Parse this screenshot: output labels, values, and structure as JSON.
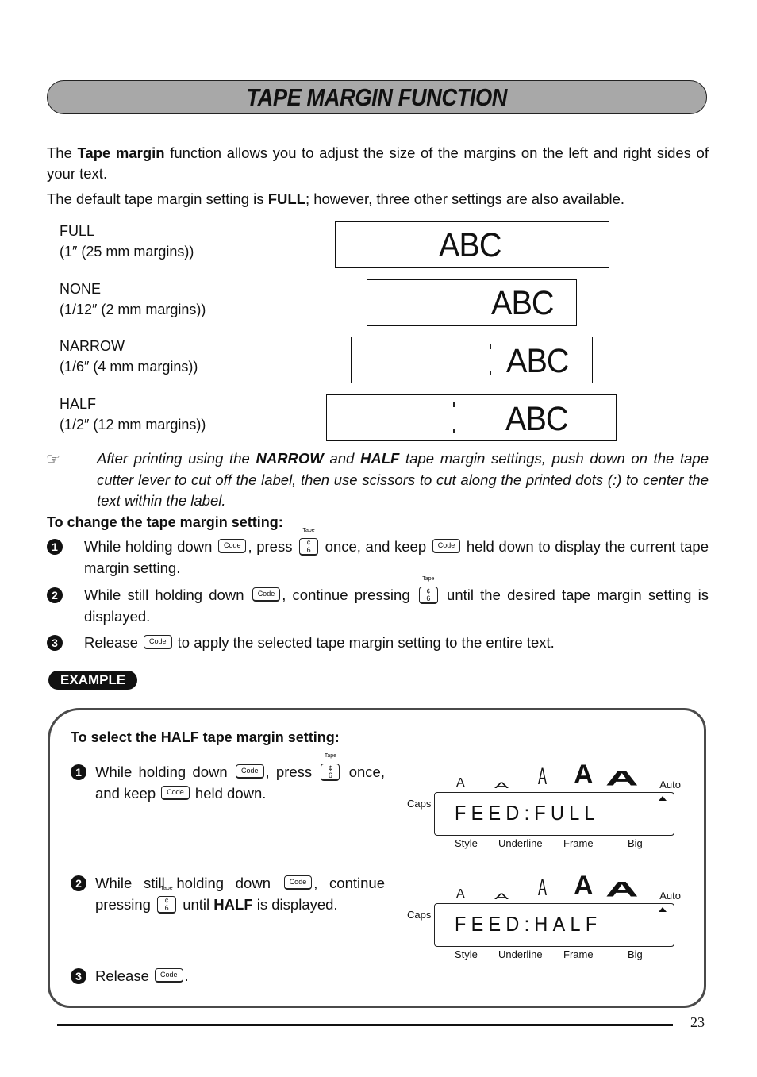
{
  "page": {
    "title": "TAPE MARGIN FUNCTION",
    "intro": {
      "p1_pre": "The ",
      "p1_bold": "Tape margin",
      "p1_post": " function allows you to adjust the size of the margins on the left and right sides of your text.",
      "p2_pre": "The default tape margin setting is ",
      "p2_bold": "FULL",
      "p2_post": "; however, three other settings are also available."
    },
    "settings": [
      {
        "name": "FULL",
        "detail": "(1″ (25 mm margins))",
        "sample": "ABC"
      },
      {
        "name": "NONE",
        "detail": "(1/12″ (2 mm margins))",
        "sample": "ABC"
      },
      {
        "name": "NARROW",
        "detail": "(1/6″ (4 mm margins))",
        "sample": "ABC"
      },
      {
        "name": "HALF",
        "detail": "(1/2″ (12 mm margins))",
        "sample": "ABC"
      }
    ],
    "note": {
      "icon": "pointing-hand-icon",
      "pre": "After printing using the ",
      "b1": "NARROW",
      "mid": " and ",
      "b2": "HALF",
      "post": " tape margin settings, push down on the tape cutter lever to cut off the label, then use scissors to cut along the printed dots (:) to center the text within the label."
    },
    "subhead": "To change the tape margin setting:",
    "keys": {
      "code": "Code",
      "tape_caption": "Tape",
      "tape_top": "¢",
      "tape_bottom": "6"
    },
    "steps": [
      {
        "num": "1",
        "a": "While holding down ",
        "b": ", press ",
        "c": " once, and keep ",
        "d": " held down to display the current tape margin setting."
      },
      {
        "num": "2",
        "a": "While still holding down ",
        "b": ", continue pressing ",
        "c": " until the desired tape margin setting is displayed."
      },
      {
        "num": "3",
        "a": "Release ",
        "b": " to apply the selected tape margin setting to the entire text."
      }
    ],
    "example": {
      "badge": "EXAMPLE",
      "subhead": "To select the HALF tape margin setting:",
      "steps": [
        {
          "num": "1",
          "a": "While holding down ",
          "b": ", press ",
          "c": " once, and keep ",
          "d": " held down."
        },
        {
          "num": "2",
          "a": "While still holding down ",
          "b": ", continue pressing ",
          "c": " until ",
          "bold": "HALF",
          "d": " is displayed."
        },
        {
          "num": "3",
          "a": "Release ",
          "b": "."
        }
      ],
      "lcd_indicators": {
        "top_glyph": "A",
        "auto": "Auto",
        "caps": "Caps",
        "bottom": [
          "Style",
          "Underline",
          "Frame",
          "Big"
        ]
      },
      "displays": [
        "FEED:FULL",
        "FEED:HALF"
      ]
    },
    "page_number": "23"
  }
}
